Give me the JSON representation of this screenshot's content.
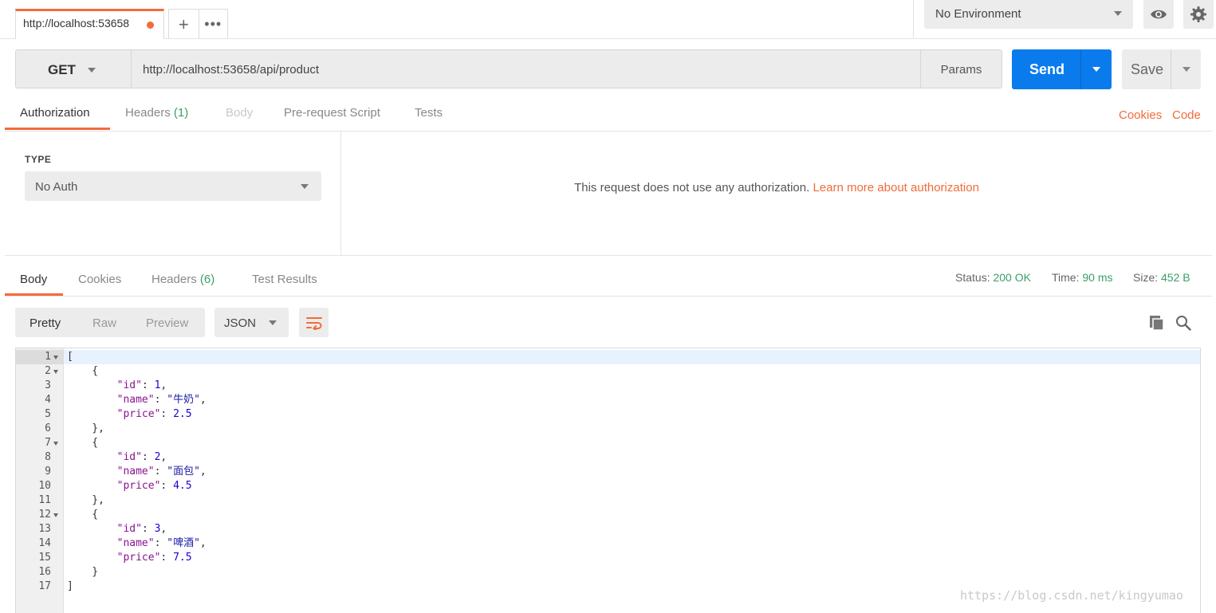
{
  "tabs": {
    "active_tab_label": "http://localhost:53658",
    "new_tab_icon": "plus-icon",
    "more_icon": "ellipsis-icon"
  },
  "environment": {
    "selected": "No Environment"
  },
  "request": {
    "method": "GET",
    "url": "http://localhost:53658/api/product",
    "params_label": "Params",
    "send_label": "Send",
    "save_label": "Save"
  },
  "request_tabs": {
    "authorization": "Authorization",
    "headers": "Headers",
    "headers_count": "(1)",
    "body": "Body",
    "prerequest": "Pre-request Script",
    "tests": "Tests",
    "cookies_link": "Cookies",
    "code_link": "Code"
  },
  "auth": {
    "type_label": "TYPE",
    "type_value": "No Auth",
    "message": "This request does not use any authorization.",
    "learn_more": "Learn more about authorization"
  },
  "response_tabs": {
    "body": "Body",
    "cookies": "Cookies",
    "headers": "Headers",
    "headers_count": "(6)",
    "test_results": "Test Results"
  },
  "response_status": {
    "status_label": "Status:",
    "status_value": "200 OK",
    "time_label": "Time:",
    "time_value": "90 ms",
    "size_label": "Size:",
    "size_value": "452 B"
  },
  "response_view": {
    "pretty": "Pretty",
    "raw": "Raw",
    "preview": "Preview",
    "format": "JSON"
  },
  "code_lines": [
    {
      "n": "1",
      "text": "["
    },
    {
      "n": "2",
      "text": "    {"
    },
    {
      "n": "3",
      "text": "        \"id\": 1,"
    },
    {
      "n": "4",
      "text": "        \"name\": \"牛奶\","
    },
    {
      "n": "5",
      "text": "        \"price\": 2.5"
    },
    {
      "n": "6",
      "text": "    },"
    },
    {
      "n": "7",
      "text": "    {"
    },
    {
      "n": "8",
      "text": "        \"id\": 2,"
    },
    {
      "n": "9",
      "text": "        \"name\": \"面包\","
    },
    {
      "n": "10",
      "text": "        \"price\": 4.5"
    },
    {
      "n": "11",
      "text": "    },"
    },
    {
      "n": "12",
      "text": "    {"
    },
    {
      "n": "13",
      "text": "        \"id\": 3,"
    },
    {
      "n": "14",
      "text": "        \"name\": \"啤酒\","
    },
    {
      "n": "15",
      "text": "        \"price\": 7.5"
    },
    {
      "n": "16",
      "text": "    }"
    },
    {
      "n": "17",
      "text": "]"
    }
  ],
  "fold_lines": [
    "1",
    "2",
    "7",
    "12"
  ],
  "watermark": "https://blog.csdn.net/kingyumao",
  "colors": {
    "accent_orange": "#f26b3a",
    "send_blue": "#097bed",
    "status_green": "#3a9e6a"
  }
}
